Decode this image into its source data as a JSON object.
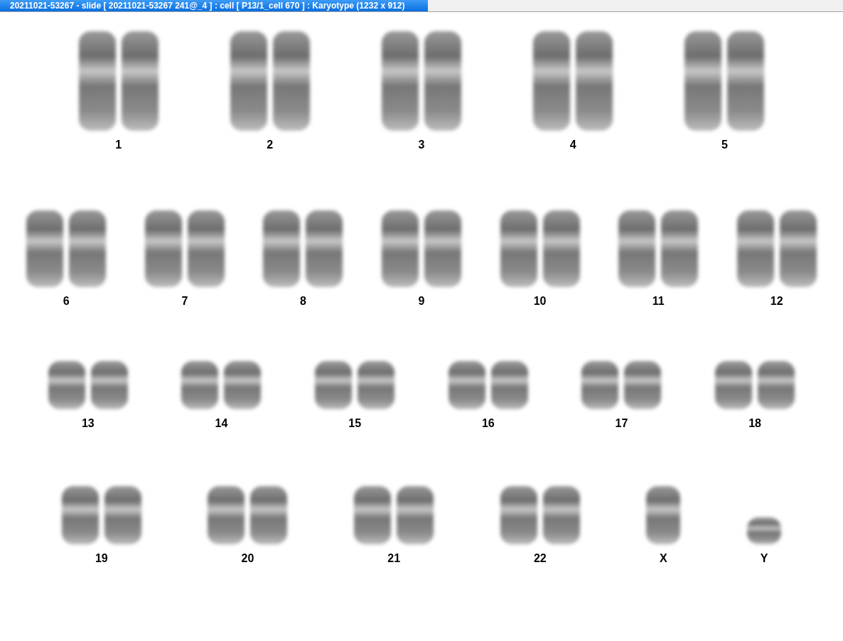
{
  "window": {
    "title": "20211021-53267 - slide [ 20211021-53267 241@_4 ] : cell [ P13/1_cell 670 ] : Karyotype  (1232 x 912)"
  },
  "karyotype": {
    "rows": [
      [
        {
          "label": "1",
          "kind": "pair"
        },
        {
          "label": "2",
          "kind": "pair"
        },
        {
          "label": "3",
          "kind": "pair"
        },
        {
          "label": "4",
          "kind": "pair"
        },
        {
          "label": "5",
          "kind": "pair"
        }
      ],
      [
        {
          "label": "6",
          "kind": "pair"
        },
        {
          "label": "7",
          "kind": "pair"
        },
        {
          "label": "8",
          "kind": "pair"
        },
        {
          "label": "9",
          "kind": "pair"
        },
        {
          "label": "10",
          "kind": "pair"
        },
        {
          "label": "11",
          "kind": "pair"
        },
        {
          "label": "12",
          "kind": "pair"
        }
      ],
      [
        {
          "label": "13",
          "kind": "pair"
        },
        {
          "label": "14",
          "kind": "pair"
        },
        {
          "label": "15",
          "kind": "pair"
        },
        {
          "label": "16",
          "kind": "pair"
        },
        {
          "label": "17",
          "kind": "pair"
        },
        {
          "label": "18",
          "kind": "pair"
        }
      ],
      [
        {
          "label": "19",
          "kind": "pair"
        },
        {
          "label": "20",
          "kind": "pair"
        },
        {
          "label": "21",
          "kind": "pair"
        },
        {
          "label": "22",
          "kind": "pair"
        },
        {
          "label": "X",
          "kind": "single"
        },
        {
          "label": "Y",
          "kind": "single"
        }
      ]
    ]
  }
}
